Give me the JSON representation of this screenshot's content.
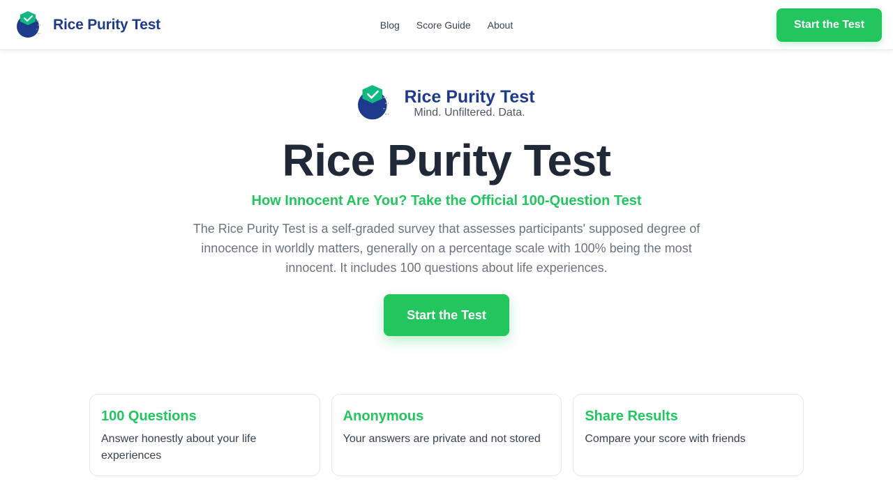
{
  "header": {
    "brand_name": "Rice Purity Test",
    "nav": [
      {
        "label": "Blog"
      },
      {
        "label": "Score Guide"
      },
      {
        "label": "About"
      }
    ],
    "cta_label": "Start the Test"
  },
  "hero": {
    "brand_name": "Rice Purity Test",
    "tagline": "Mind. Unfiltered. Data.",
    "title": "Rice Purity Test",
    "subtitle": "How Innocent Are You? Take the Official 100-Question Test",
    "description": "The Rice Purity Test is a self-graded survey that assesses participants' supposed degree of innocence in worldly matters, generally on a percentage scale with 100% being the most innocent. It includes 100 questions about life experiences.",
    "cta_label": "Start the Test"
  },
  "features": [
    {
      "title": "100 Questions",
      "text": "Answer honestly about your life experiences"
    },
    {
      "title": "Anonymous",
      "text": "Your answers are private and not stored"
    },
    {
      "title": "Share Results",
      "text": "Compare your score with friends"
    }
  ],
  "colors": {
    "accent": "#22c55e",
    "brand_navy": "#1e3a8a",
    "heading": "#1f2937",
    "body_text": "#6b7280"
  },
  "icons": {
    "logo": "brain-checkmark-logo-icon"
  }
}
